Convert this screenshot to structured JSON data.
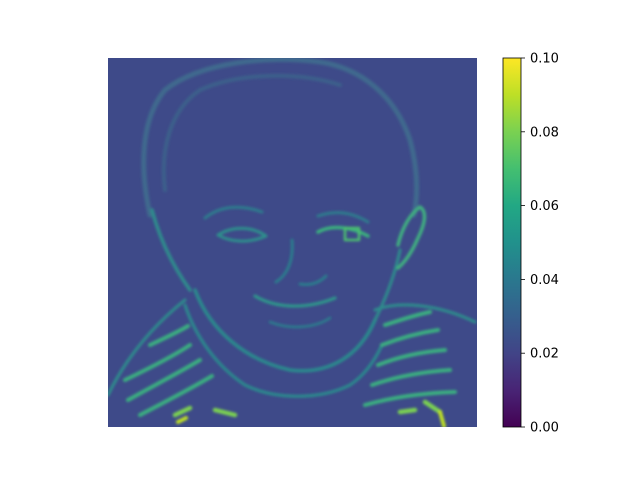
{
  "chart_data": {
    "type": "heatmap",
    "title": "",
    "xlabel": "",
    "ylabel": "",
    "x_ticks_visible": false,
    "y_ticks_visible": false,
    "colormap": "viridis",
    "value_range": [
      0.0,
      0.1
    ],
    "typical_background_value": 0.02,
    "max_highlight_value": 0.1,
    "image_content": "edge-detection style heatmap of a child's face with a striped collar",
    "colorbar": {
      "ticks": [
        0.0,
        0.02,
        0.04,
        0.06,
        0.08,
        0.1
      ],
      "tick_labels": [
        "0.00",
        "0.02",
        "0.04",
        "0.06",
        "0.08",
        "0.10"
      ]
    },
    "colors": {
      "background": "#3e4a89",
      "low": "#440154",
      "mid": "#21918c",
      "high": "#fde725"
    }
  }
}
